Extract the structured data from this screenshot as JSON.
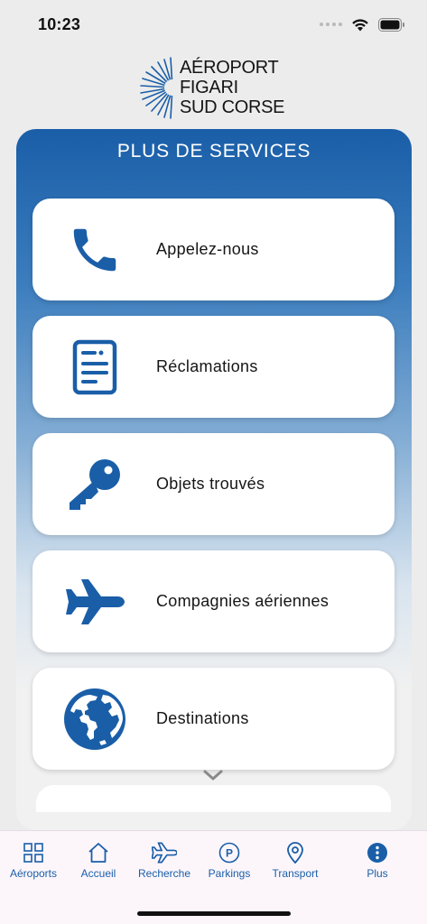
{
  "status_bar": {
    "time": "10:23"
  },
  "logo": {
    "line1": "AÉROPORT",
    "line2": "FIGARI",
    "line3": "SUD CORSE"
  },
  "panel": {
    "title": "PLUS DE SERVICES"
  },
  "services": [
    {
      "label": "Appelez-nous",
      "icon": "phone-icon"
    },
    {
      "label": "Réclamations",
      "icon": "document-icon"
    },
    {
      "label": "Objets trouvés",
      "icon": "key-icon"
    },
    {
      "label": "Compagnies aériennes",
      "icon": "airplane-icon"
    },
    {
      "label": "Destinations",
      "icon": "globe-icon"
    }
  ],
  "tabs": [
    {
      "label": "Aéroports",
      "icon": "grid-icon"
    },
    {
      "label": "Accueil",
      "icon": "home-icon"
    },
    {
      "label": "Recherche",
      "icon": "airplane-icon"
    },
    {
      "label": "Parkings",
      "icon": "parking-icon"
    },
    {
      "label": "Transport",
      "icon": "location-pin-icon"
    },
    {
      "label": "Plus",
      "icon": "more-icon"
    }
  ],
  "colors": {
    "brand": "#1a5ea8",
    "background": "#ececec",
    "tabbar": "#fcf6fb"
  }
}
